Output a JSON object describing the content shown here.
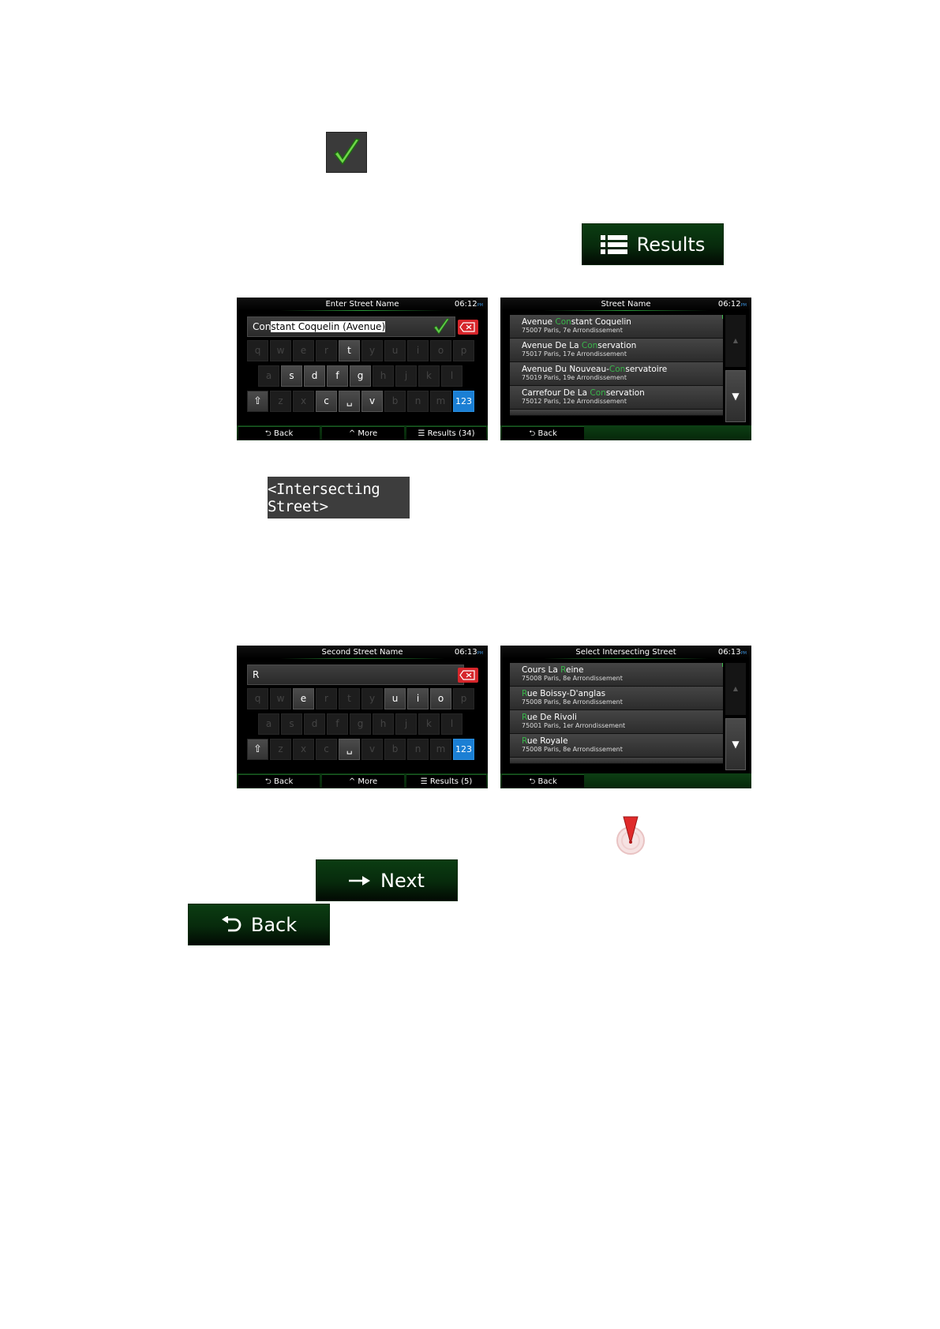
{
  "buttons": {
    "results_label": "Results",
    "intersecting_label": "<Intersecting Street>",
    "next_label": "Next",
    "back_label": "Back"
  },
  "screen1": {
    "title": "Enter Street Name",
    "time": "06:12",
    "ampm": "PM",
    "input_typed": "Con",
    "input_suggested": "stant Coquelin (Avenue)",
    "row1": [
      "q",
      "w",
      "e",
      "r",
      "t",
      "y",
      "u",
      "i",
      "o",
      "p"
    ],
    "row2": [
      "a",
      "s",
      "d",
      "f",
      "g",
      "h",
      "j",
      "k",
      "l"
    ],
    "row3": [
      "z",
      "x",
      "c",
      "v",
      "b",
      "n",
      "m"
    ],
    "num_key": "123",
    "back": "Back",
    "more": "More",
    "results": "Results (34)"
  },
  "screen2": {
    "title": "Street Name",
    "time": "06:12",
    "ampm": "PM",
    "items": [
      {
        "pre": "Avenue ",
        "hl": "Con",
        "post": "stant Coquelin",
        "addr": "75007 Paris, 7e Arrondissement"
      },
      {
        "pre": "Avenue De La ",
        "hl": "Con",
        "post": "servation",
        "addr": "75017 Paris, 17e Arrondissement"
      },
      {
        "pre": "Avenue Du Nouveau-",
        "hl": "Con",
        "post": "servatoire",
        "addr": "75019 Paris, 19e Arrondissement"
      },
      {
        "pre": "Carrefour De La ",
        "hl": "Con",
        "post": "servation",
        "addr": "75012 Paris, 12e Arrondissement"
      }
    ],
    "back": "Back"
  },
  "screen3": {
    "title": "Second Street Name",
    "time": "06:13",
    "ampm": "PM",
    "input_typed": "R",
    "num_key": "123",
    "back": "Back",
    "more": "More",
    "results": "Results (5)"
  },
  "screen4": {
    "title": "Select Intersecting Street",
    "time": "06:13",
    "ampm": "PM",
    "items": [
      {
        "pre": "Cours La ",
        "hl": "R",
        "post": "eine",
        "addr": "75008 Paris, 8e Arrondissement"
      },
      {
        "pre": "",
        "hl": "R",
        "post": "ue Boissy-D'anglas",
        "addr": "75008 Paris, 8e Arrondissement"
      },
      {
        "pre": "",
        "hl": "R",
        "post": "ue De Rivoli",
        "addr": "75001 Paris, 1er Arrondissement"
      },
      {
        "pre": "",
        "hl": "R",
        "post": "ue Royale",
        "addr": "75008 Paris, 8e Arrondissement"
      }
    ],
    "back": "Back"
  },
  "colors": {
    "accent_green": "#39b54a",
    "delete_red": "#d6262b",
    "num_blue": "#1b7fd4"
  },
  "icons": [
    "checkmark-icon",
    "list-icon",
    "arrow-right-icon",
    "back-arrow-icon",
    "map-pin-icon",
    "shift-icon",
    "backspace-icon",
    "space-icon",
    "chevron-up-icon",
    "triangle-down-icon"
  ]
}
